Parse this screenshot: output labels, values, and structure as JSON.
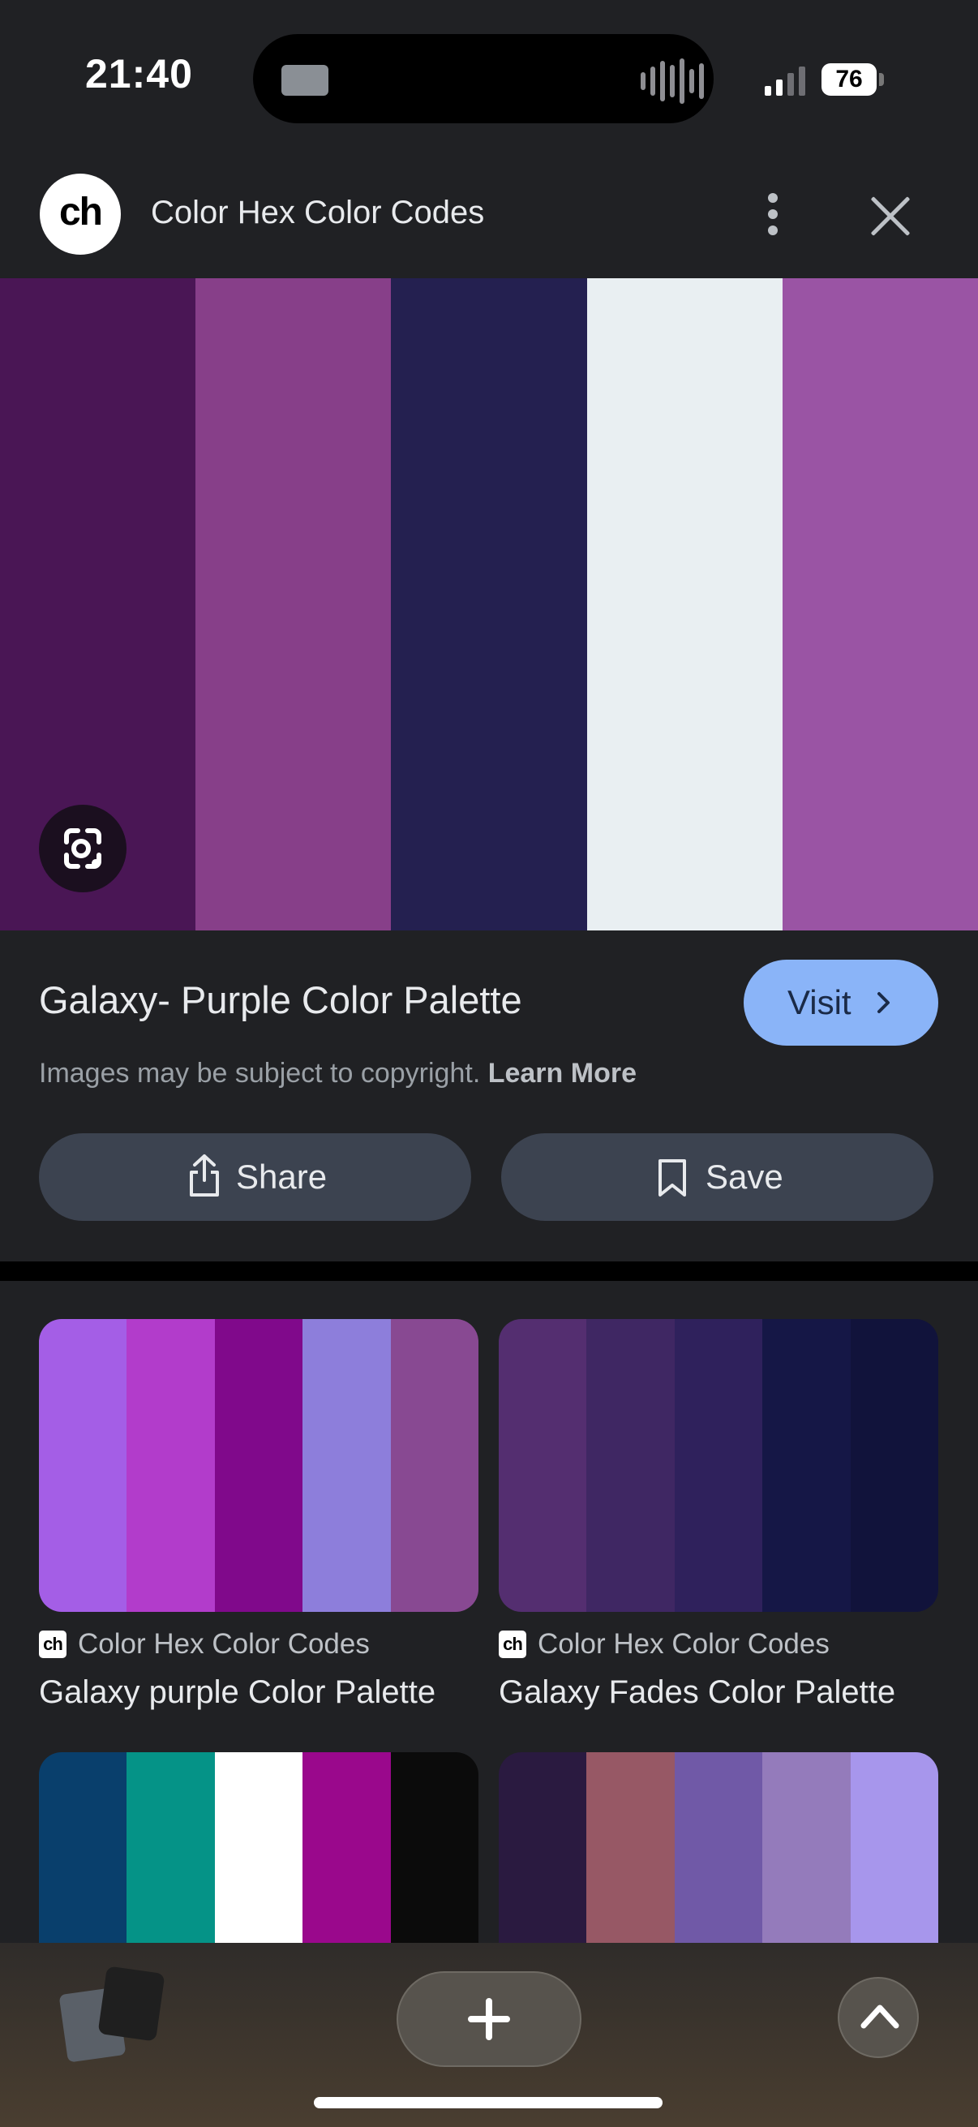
{
  "status_bar": {
    "time": "21:40",
    "battery": "76"
  },
  "header": {
    "logo_text": "ch",
    "title": "Color Hex Color Codes"
  },
  "hero": {
    "swatches": [
      "#4a1655",
      "#873f89",
      "#242050",
      "#e9eff2",
      "#9a54a4"
    ]
  },
  "result": {
    "title": "Galaxy- Purple Color Palette",
    "visit_label": "Visit",
    "copyright": "Images may be subject to copyright.",
    "learn_more": "Learn More",
    "share_label": "Share",
    "save_label": "Save"
  },
  "grid": [
    {
      "source": "Color Hex Color Codes",
      "favicon": "ch",
      "title": "Galaxy purple Color Palette",
      "swatches": [
        "#a45ee6",
        "#b23ccb",
        "#80098b",
        "#8d7edb",
        "#884992"
      ]
    },
    {
      "source": "Color Hex Color Codes",
      "favicon": "ch",
      "title": "Galaxy Fades Color Palette",
      "swatches": [
        "#542e70",
        "#3f2763",
        "#2f215c",
        "#151746",
        "#11133b"
      ]
    },
    {
      "source": "",
      "favicon": "",
      "title": "",
      "swatches": [
        "#093f6c",
        "#059387",
        "#ffffff",
        "#9a088c",
        "#0b0b0b"
      ]
    },
    {
      "source": "",
      "favicon": "",
      "title": "",
      "swatches": [
        "#2a1a40",
        "#975865",
        "#7059a7",
        "#947bbb",
        "#a796ec"
      ]
    }
  ],
  "colors": {
    "visit_bg": "#8ab4f8",
    "pill_bg": "#3c4350",
    "page_bg": "#202124"
  },
  "icons": [
    "lens-icon",
    "share-icon",
    "bookmark-icon",
    "plus-icon",
    "chevron-up-icon",
    "more-vert-icon",
    "close-icon"
  ]
}
